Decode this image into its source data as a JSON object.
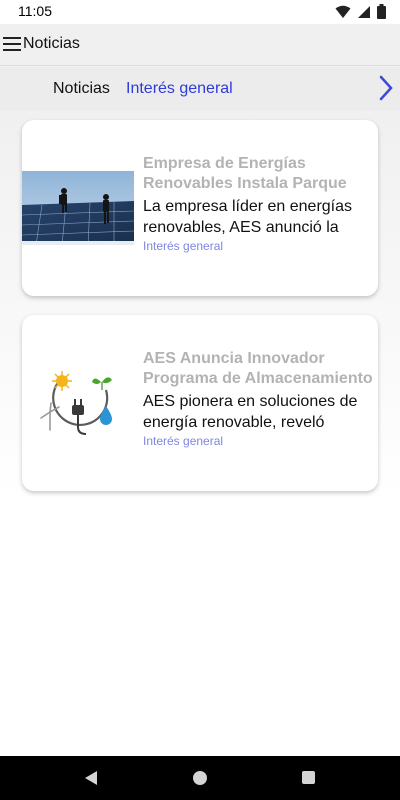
{
  "status_bar": {
    "time": "11:05"
  },
  "app_bar": {
    "title": "Noticias"
  },
  "tabs": [
    {
      "label": "Noticias"
    },
    {
      "label": "Interés general"
    }
  ],
  "articles": [
    {
      "title": "Empresa de Energías Renovables Instala Parque",
      "summary": "La empresa líder en energías renovables, AES anunció la",
      "category": "Interés general",
      "image_icon": "solar-panels-photo"
    },
    {
      "title": "AES Anuncia Innovador Programa de Almacenamiento",
      "summary": "AES pionera en soluciones de energía renovable, reveló",
      "category": "Interés general",
      "image_icon": "renewable-energy-illustration"
    }
  ],
  "colors": {
    "accent": "#2f3bd8",
    "category": "#7e87e0",
    "title_muted": "#b3b3b3"
  }
}
